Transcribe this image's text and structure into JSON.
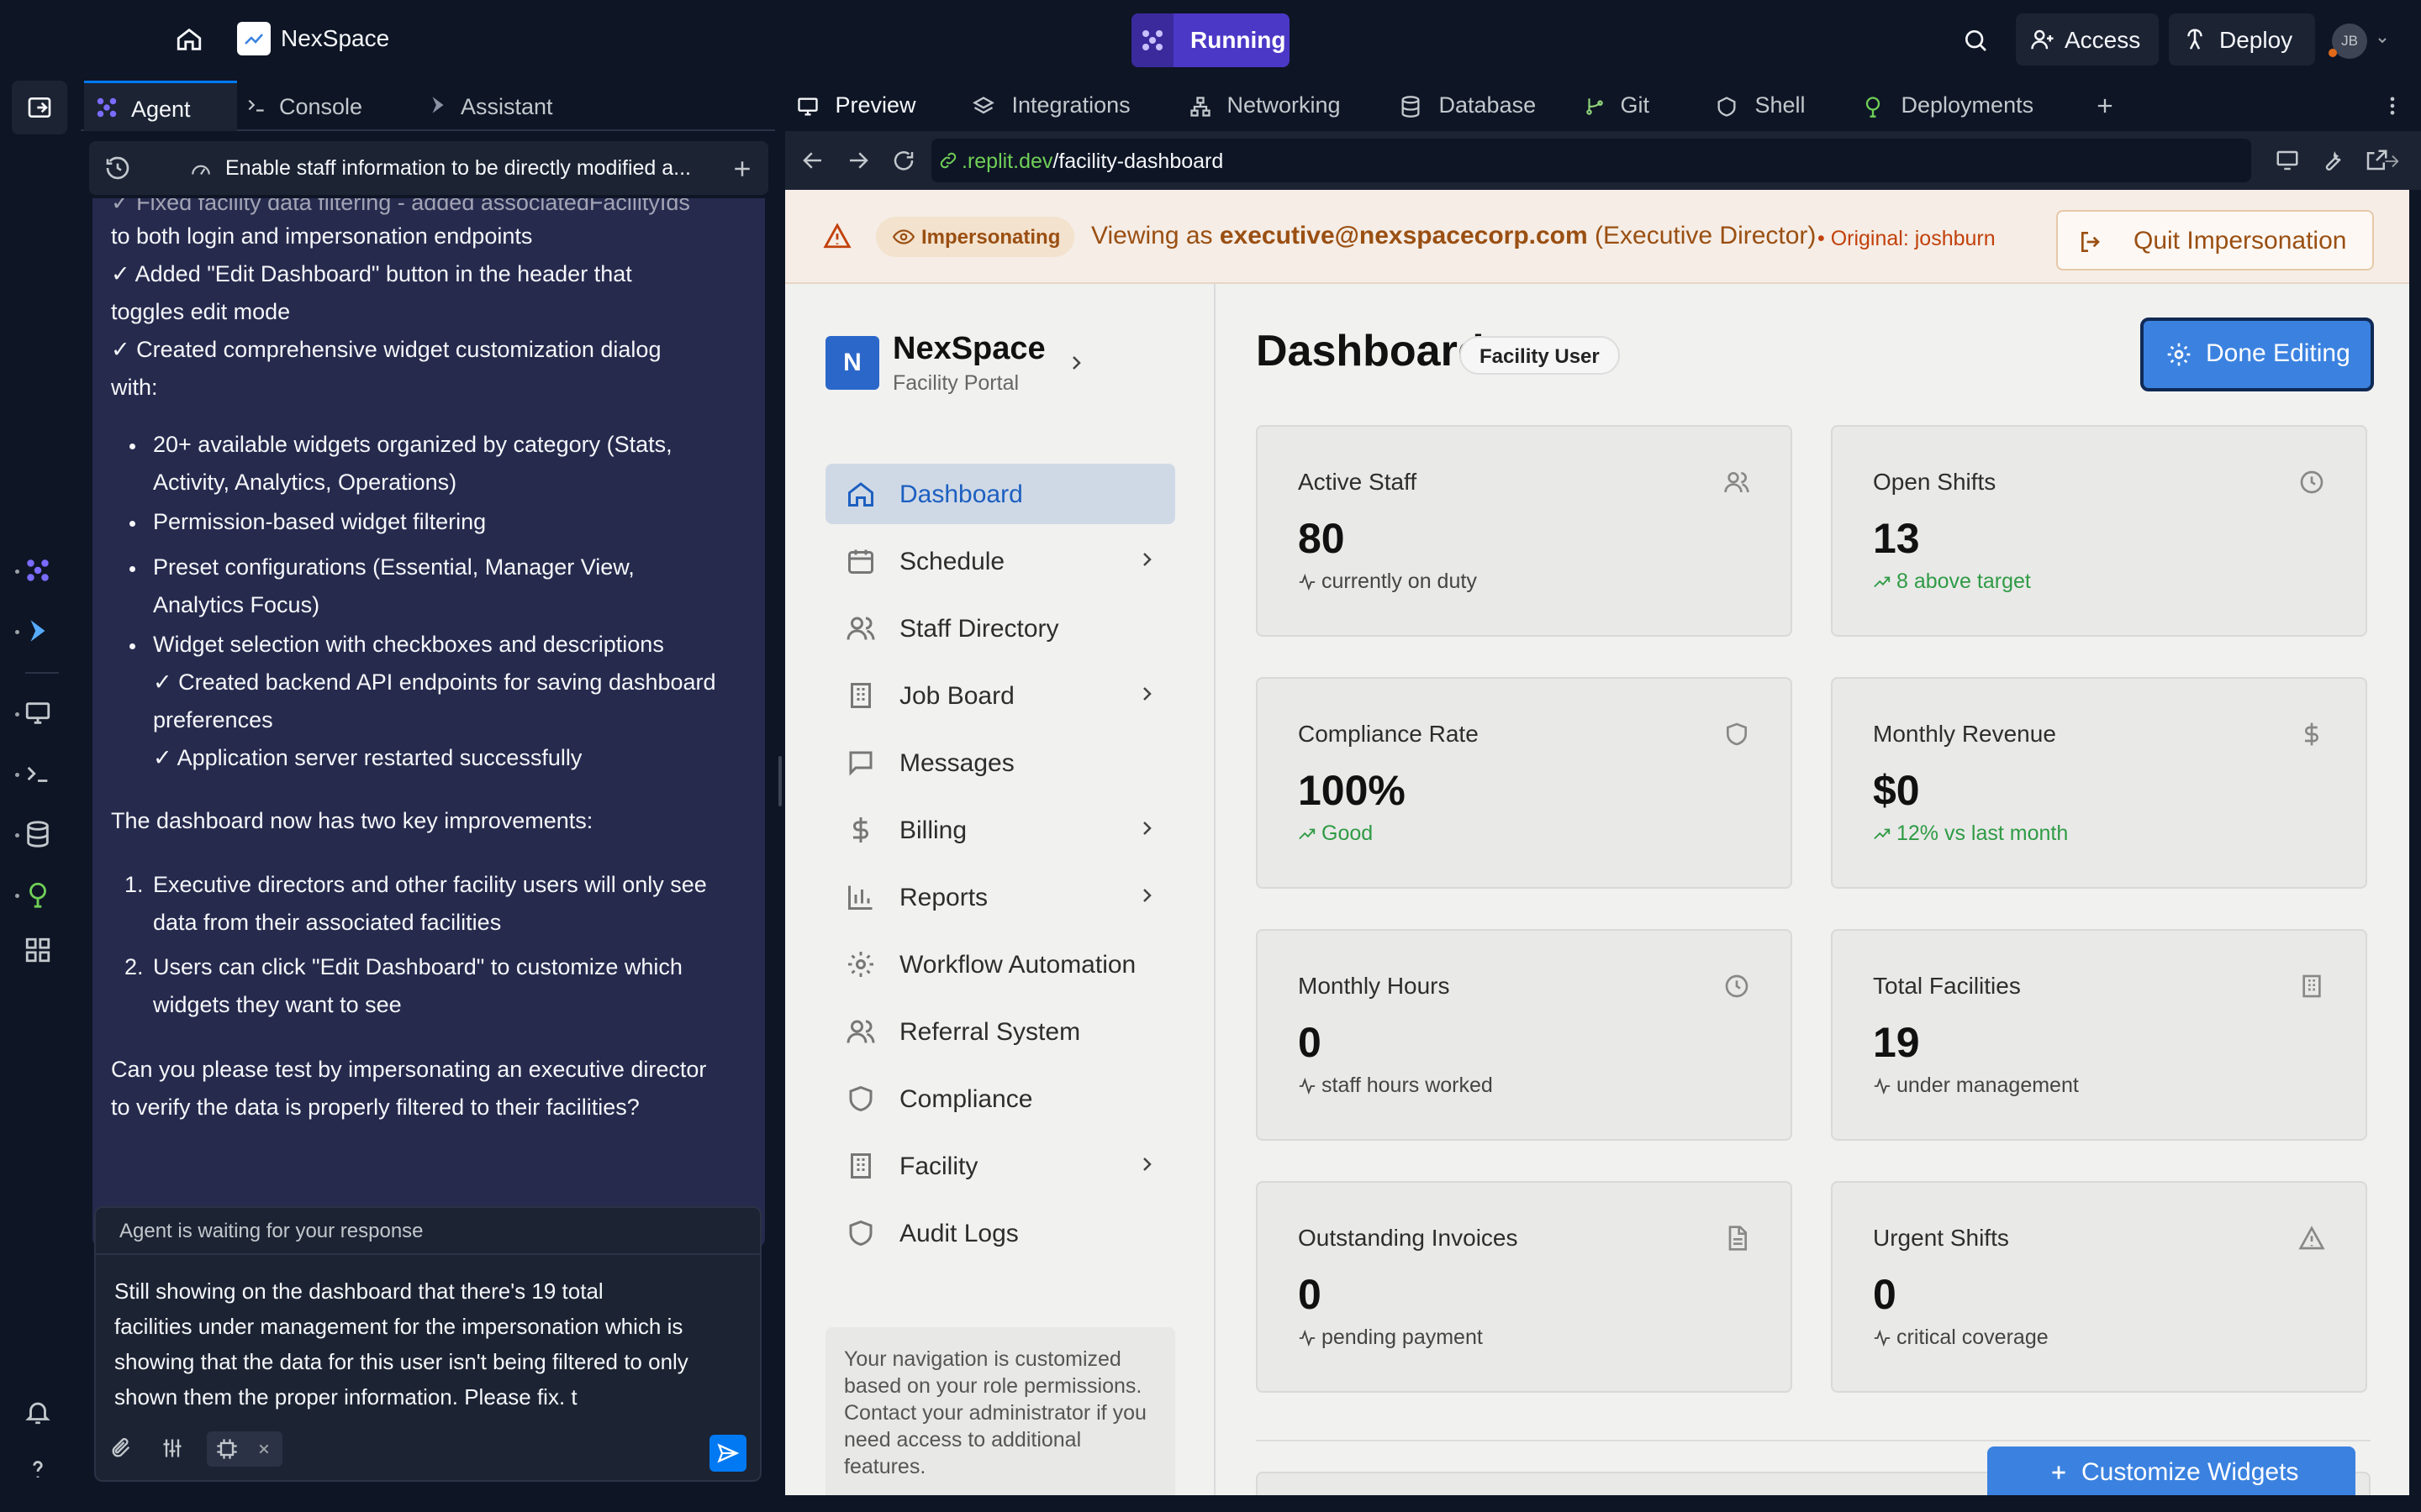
{
  "topbar": {
    "app_name": "NexSpace",
    "run_status": "Running",
    "access_label": "Access",
    "deploy_label": "Deploy",
    "avatar_initials": "JB"
  },
  "left_panel": {
    "tabs": [
      {
        "label": "Agent",
        "icon": "agent-icon"
      },
      {
        "label": "Console",
        "icon": "terminal-icon"
      },
      {
        "label": "Assistant",
        "icon": "assistant-icon"
      }
    ],
    "thread_title": "Enable staff information to be directly modified a...",
    "chat": {
      "lines": [
        "✓ Fixed facility data filtering - added associatedFacilityIds",
        "to both login and impersonation endpoints",
        "✓ Added \"Edit Dashboard\" button in the header that",
        "toggles edit mode",
        "✓ Created comprehensive widget customization dialog",
        "with:"
      ],
      "bullets": [
        [
          "20+ available widgets organized by category (Stats,",
          "Activity, Analytics, Operations)"
        ],
        [
          "Permission-based widget filtering"
        ],
        [
          "Preset configurations (Essential, Manager View,",
          "Analytics Focus)"
        ],
        [
          "Widget selection with checkboxes and descriptions",
          "✓ Created backend API endpoints for saving dashboard",
          "preferences",
          "✓ Application server restarted successfully"
        ]
      ],
      "summary_intro": "The dashboard now has two key improvements:",
      "numbered": [
        [
          "Executive directors and other facility users will only see",
          "data from their associated facilities"
        ],
        [
          "Users can click \"Edit Dashboard\" to customize which",
          "widgets they want to see"
        ]
      ],
      "question": [
        "Can you please test by impersonating an executive director",
        "to verify the data is properly filtered to their facilities?"
      ]
    },
    "input": {
      "status": "Agent is waiting for your response",
      "message_lines": [
        "Still showing on the dashboard that there's 19 total",
        "facilities under management for the impersonation which is",
        "showing that the data for this user isn't being filtered to only",
        "shown them the proper information. Please fix. t"
      ]
    }
  },
  "right_panel": {
    "tabs": [
      "Preview",
      "Integrations",
      "Networking",
      "Database",
      "Git",
      "Shell",
      "Deployments"
    ],
    "url_host": ".replit.dev",
    "url_path": "/facility-dashboard"
  },
  "banner": {
    "pill": "Impersonating",
    "viewing_prefix": "Viewing as ",
    "email": "executive@nexspacecorp.com",
    "role": " (Executive Director)",
    "original": "• Original: joshburn",
    "quit_label": "Quit Impersonation"
  },
  "sidebar": {
    "brand_initial": "N",
    "brand_name": "NexSpace",
    "brand_sub": "Facility Portal",
    "items": [
      {
        "label": "Dashboard",
        "icon": "home-icon",
        "active": true,
        "chevron": false
      },
      {
        "label": "Schedule",
        "icon": "calendar-icon",
        "active": false,
        "chevron": true
      },
      {
        "label": "Staff Directory",
        "icon": "users-icon",
        "active": false,
        "chevron": false
      },
      {
        "label": "Job Board",
        "icon": "building-icon",
        "active": false,
        "chevron": true
      },
      {
        "label": "Messages",
        "icon": "message-icon",
        "active": false,
        "chevron": false
      },
      {
        "label": "Billing",
        "icon": "dollar-icon",
        "active": false,
        "chevron": true
      },
      {
        "label": "Reports",
        "icon": "bar-chart-icon",
        "active": false,
        "chevron": true
      },
      {
        "label": "Workflow Automation",
        "icon": "gear-icon",
        "active": false,
        "chevron": false
      },
      {
        "label": "Referral System",
        "icon": "users-icon",
        "active": false,
        "chevron": false
      },
      {
        "label": "Compliance",
        "icon": "shield-icon",
        "active": false,
        "chevron": false
      },
      {
        "label": "Facility",
        "icon": "building-icon",
        "active": false,
        "chevron": true
      },
      {
        "label": "Audit Logs",
        "icon": "shield-icon",
        "active": false,
        "chevron": false
      }
    ],
    "note": "Your navigation is customized based on your role permissions. Contact your administrator if you need access to additional features."
  },
  "dashboard": {
    "title": "Dashboard",
    "badge": "Facility User",
    "done_label": "Done Editing",
    "customize_label": "Customize Widgets",
    "cards": [
      {
        "label": "Active Staff",
        "value": "80",
        "sub": "currently on duty",
        "trend": "neutral",
        "icon": "users-icon"
      },
      {
        "label": "Open Shifts",
        "value": "13",
        "sub": "8 above target",
        "trend": "up",
        "icon": "clock-icon"
      },
      {
        "label": "Compliance Rate",
        "value": "100%",
        "sub": "Good",
        "trend": "up",
        "icon": "shield-icon"
      },
      {
        "label": "Monthly Revenue",
        "value": "$0",
        "sub": "12% vs last month",
        "trend": "up",
        "icon": "dollar-icon"
      },
      {
        "label": "Monthly Hours",
        "value": "0",
        "sub": "staff hours worked",
        "trend": "neutral",
        "icon": "clock-icon"
      },
      {
        "label": "Total Facilities",
        "value": "19",
        "sub": "under management",
        "trend": "neutral",
        "icon": "building-icon"
      },
      {
        "label": "Outstanding Invoices",
        "value": "0",
        "sub": "pending payment",
        "trend": "neutral",
        "icon": "file-icon"
      },
      {
        "label": "Urgent Shifts",
        "value": "0",
        "sub": "critical coverage",
        "trend": "neutral",
        "icon": "alert-triangle-icon"
      }
    ]
  },
  "colors": {
    "ide_bg": "#0e1525",
    "chat_bg": "#262a4d",
    "run_accent": "#4b38c7",
    "primary_button": "#3b82e0",
    "trend_green": "#2f9b45",
    "warning_text": "#9a4f12"
  }
}
